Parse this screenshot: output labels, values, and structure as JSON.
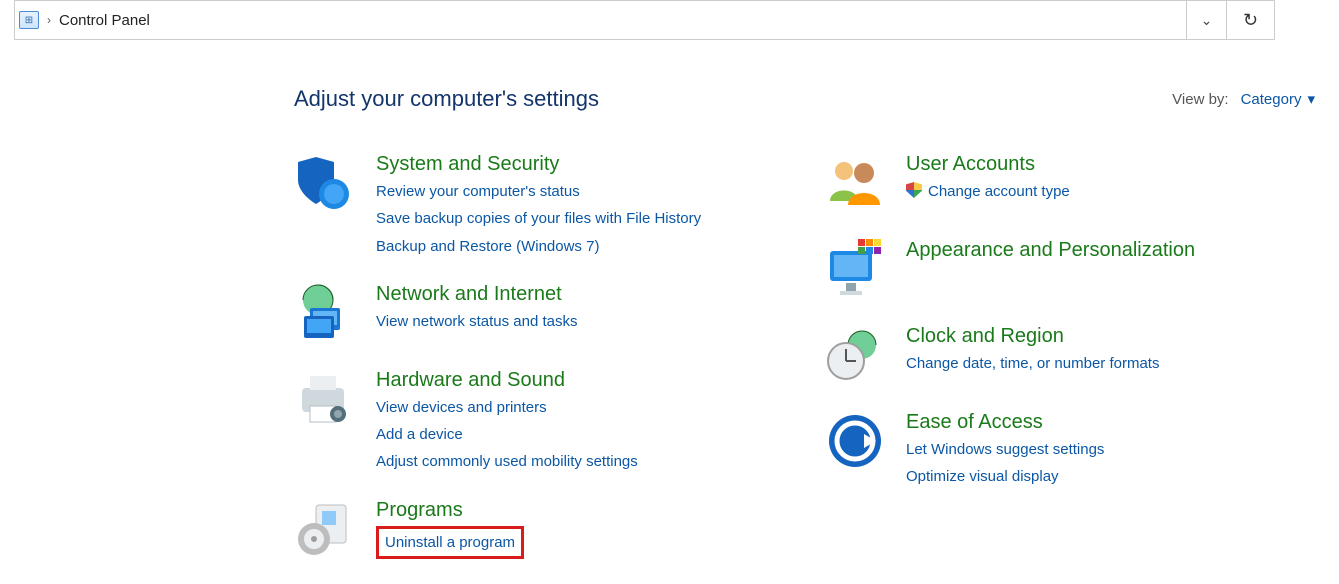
{
  "address_bar": {
    "breadcrumb_sep": "›",
    "location": "Control Panel",
    "dropdown_glyph": "⌄",
    "refresh_glyph": "↻"
  },
  "header": {
    "title": "Adjust your computer's settings",
    "viewby_label": "View by:",
    "viewby_value": "Category",
    "viewby_caret": "▾"
  },
  "left": {
    "system_security": {
      "title": "System and Security",
      "links": [
        "Review your computer's status",
        "Save backup copies of your files with File History",
        "Backup and Restore (Windows 7)"
      ]
    },
    "network": {
      "title": "Network and Internet",
      "links": [
        "View network status and tasks"
      ]
    },
    "hardware": {
      "title": "Hardware and Sound",
      "links": [
        "View devices and printers",
        "Add a device",
        "Adjust commonly used mobility settings"
      ]
    },
    "programs": {
      "title": "Programs",
      "links": [
        "Uninstall a program"
      ]
    }
  },
  "right": {
    "user_accounts": {
      "title": "User Accounts",
      "links": [
        "Change account type"
      ]
    },
    "appearance": {
      "title": "Appearance and Personalization"
    },
    "clock": {
      "title": "Clock and Region",
      "links": [
        "Change date, time, or number formats"
      ]
    },
    "ease": {
      "title": "Ease of Access",
      "links": [
        "Let Windows suggest settings",
        "Optimize visual display"
      ]
    }
  }
}
